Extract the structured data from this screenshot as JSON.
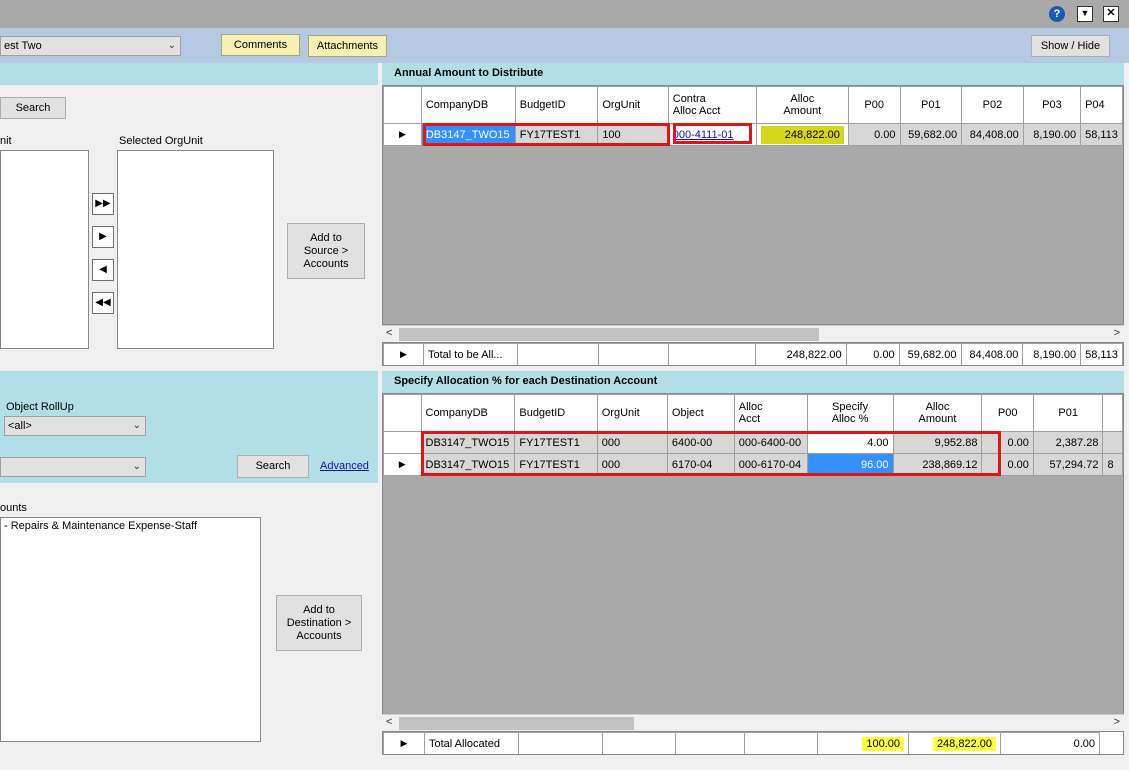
{
  "window": {
    "help_icon": "?",
    "dropdown_icon": "▼",
    "close_icon": "✕"
  },
  "toolbar": {
    "scenario_value": "est Two",
    "comments_label": "Comments",
    "attachments_label": "Attachments",
    "show_hide_label": "Show / Hide"
  },
  "source_panel": {
    "search_label": "Search",
    "orgunit_label": "nit",
    "selected_orgunit_label": "Selected OrgUnit",
    "move_all_right": "▶▶",
    "move_right": "▶",
    "move_left": "◀",
    "move_all_left": "◀◀",
    "add_source_label_1": "Add to",
    "add_source_label_2": "Source  >",
    "add_source_label_3": "Accounts"
  },
  "dest_panel": {
    "object_rollup_label": "Object RollUp",
    "object_rollup_value": "<all>",
    "second_combo_value": "",
    "search_label": "Search",
    "advanced_label": "Advanced",
    "accounts_label": "ounts",
    "accounts_items": [
      "- Repairs & Maintenance Expense-Staff"
    ],
    "add_dest_label_1": "Add to",
    "add_dest_label_2": "Destination  >",
    "add_dest_label_3": "Accounts"
  },
  "annual_grid": {
    "title": "Annual Amount to Distribute",
    "headers": [
      "CompanyDB",
      "BudgetID",
      "OrgUnit",
      "Contra\nAlloc Acct",
      "Alloc\nAmount",
      "P00",
      "P01",
      "P02",
      "P03",
      "P04"
    ],
    "row": {
      "company": "DB3147_TWO15",
      "budget": "FY17TEST1",
      "orgunit": "100",
      "contra": "000-4111-01",
      "alloc_amount": "248,822.00",
      "p00": "0.00",
      "p01": "59,682.00",
      "p02": "84,408.00",
      "p03": "8,190.00",
      "p04": "58,113"
    },
    "total": {
      "label": "Total to be All...",
      "alloc_amount": "248,822.00",
      "p00": "0.00",
      "p01": "59,682.00",
      "p02": "84,408.00",
      "p03": "8,190.00",
      "p04": "58,113"
    }
  },
  "dest_grid": {
    "title": "Specify Allocation % for each Destination Account",
    "headers": [
      "CompanyDB",
      "BudgetID",
      "OrgUnit",
      "Object",
      "Alloc\nAcct",
      "Specify\nAlloc %",
      "Alloc\nAmount",
      "P00",
      "P01"
    ],
    "rows": [
      {
        "company": "DB3147_TWO15",
        "budget": "FY17TEST1",
        "orgunit": "000",
        "object": "6400-00",
        "acct": "000-6400-00",
        "pct": "4.00",
        "amount": "9,952.88",
        "p00": "0.00",
        "p01": "2,387.28"
      },
      {
        "company": "DB3147_TWO15",
        "budget": "FY17TEST1",
        "orgunit": "000",
        "object": "6170-04",
        "acct": "000-6170-04",
        "pct": "96.00",
        "amount": "238,869.12",
        "p00": "0.00",
        "p01": "57,294.72",
        "p02_partial": "8"
      }
    ],
    "total": {
      "label": "Total Allocated",
      "pct": "100.00",
      "amount": "248,822.00",
      "p00": "0.00"
    }
  }
}
